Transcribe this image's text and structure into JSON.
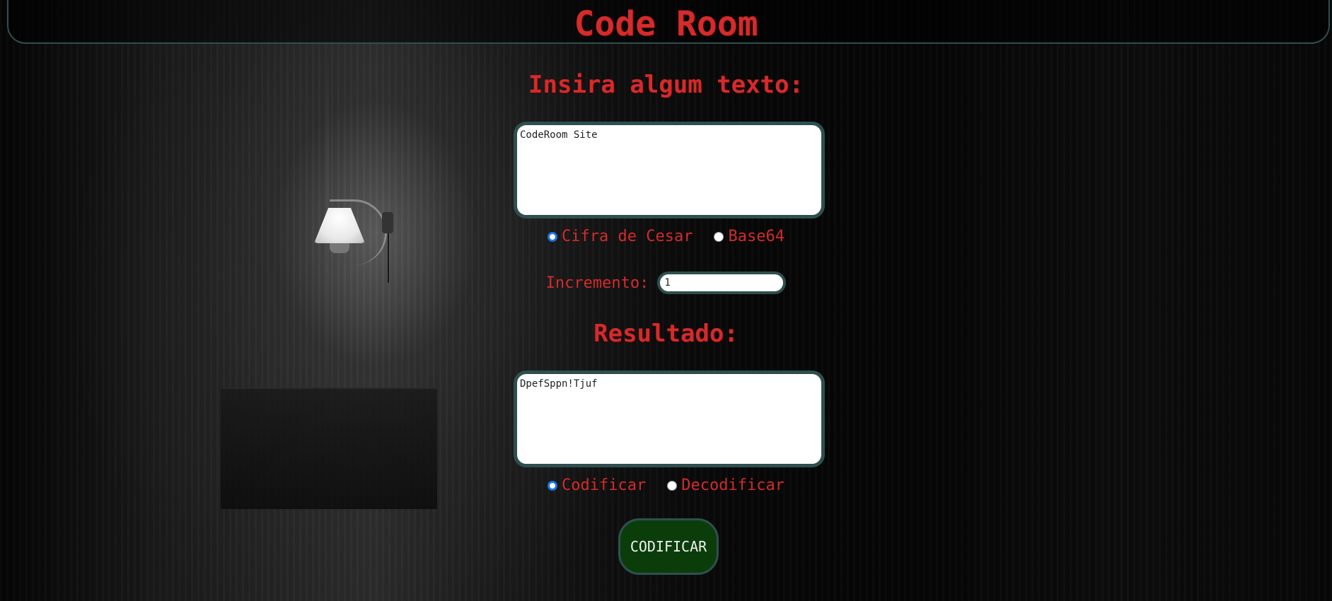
{
  "header": {
    "title": "Code Room"
  },
  "input": {
    "heading": "Insira algum texto:",
    "value": "CodeRoom Site"
  },
  "method": {
    "options": [
      {
        "label": "Cifra de Cesar",
        "checked": true
      },
      {
        "label": "Base64",
        "checked": false
      }
    ]
  },
  "increment": {
    "label": "Incremento:",
    "value": "1"
  },
  "result": {
    "heading": "Resultado:",
    "value": "DpefSppn!Tjuf"
  },
  "mode": {
    "options": [
      {
        "label": "Codificar",
        "checked": true
      },
      {
        "label": "Decodificar",
        "checked": false
      }
    ]
  },
  "action": {
    "label": "CODIFICAR"
  },
  "colors": {
    "text_red": "#d42b2b",
    "border_teal": "#2f4f4f",
    "button_green": "#0b3d0b",
    "radio_blue": "#1a73e8"
  }
}
